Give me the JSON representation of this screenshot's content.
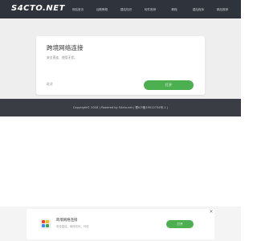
{
  "header": {
    "logo_text": "S4CTO.NET",
    "nav": [
      "网站首页",
      "谷歌教程",
      "建站知识",
      "软件推荐",
      "教程",
      "建站程序",
      "精品推荐"
    ]
  },
  "promo": {
    "title": "跨境网络连接",
    "desc": "安全直连、使用无忧。",
    "cancel_label": "取消",
    "open_label": "打开"
  },
  "footer": {
    "text": "Copyright© 2018  |  Powered by S4cto.net  |  蜀ICP备19012734号-1  |"
  },
  "ad": {
    "title": "跨境网络连接",
    "desc": "安全直连，使用无忧，可信",
    "open_label": "打开",
    "close_glyph": "×"
  },
  "colors": {
    "header_bg": "#2f333b",
    "band_bg": "#eeeeee",
    "accent_green": "#4caf50",
    "footer_bg": "#3a3e44"
  },
  "icons": {
    "app_icon": "four-color-grid-icon",
    "close": "close-icon"
  }
}
